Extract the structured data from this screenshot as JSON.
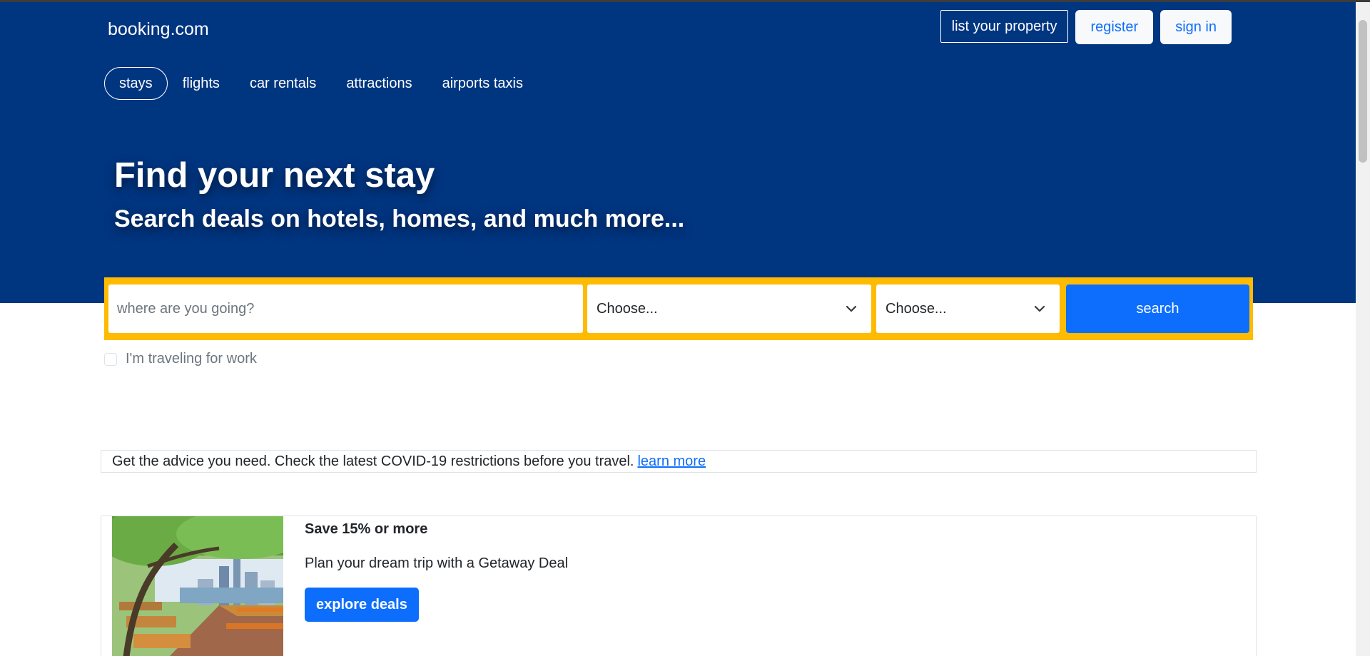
{
  "header": {
    "logo": "booking.com",
    "list_property": "list your property",
    "register": "register",
    "sign_in": "sign in"
  },
  "nav": {
    "items": [
      {
        "label": "stays",
        "active": true
      },
      {
        "label": "flights",
        "active": false
      },
      {
        "label": "car rentals",
        "active": false
      },
      {
        "label": "attractions",
        "active": false
      },
      {
        "label": "airports taxis",
        "active": false
      }
    ]
  },
  "hero": {
    "title": "Find your next stay",
    "subtitle": "Search deals on hotels, homes, and much more..."
  },
  "search": {
    "destination_placeholder": "where are you going?",
    "select1_value": "Choose...",
    "select2_value": "Choose...",
    "search_label": "search",
    "work_checkbox_label": "I'm traveling for work",
    "work_checkbox_checked": false
  },
  "notice": {
    "text": "Get the advice you need. Check the latest COVID-19 restrictions before you travel.",
    "link": "learn more"
  },
  "deal": {
    "title": "Save 15% or more",
    "text": "Plan your dream trip with a Getaway Deal",
    "button": "explore deals"
  },
  "colors": {
    "brand_blue": "#003580",
    "accent_yellow": "#febb02",
    "button_blue": "#0d6efd"
  }
}
